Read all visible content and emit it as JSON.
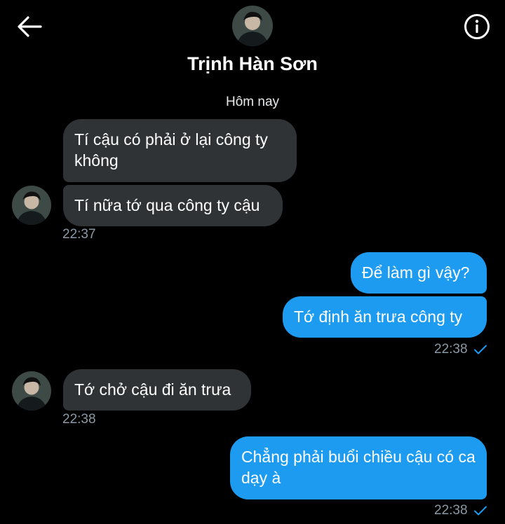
{
  "header": {
    "contact_name": "Trịnh Hàn Sơn",
    "back_icon": "arrow-left-icon",
    "info_icon": "info-circle-icon"
  },
  "date_separator": "Hôm nay",
  "messages": [
    {
      "direction": "in",
      "text": "Tí cậu có phải ở lại công ty không"
    },
    {
      "direction": "in",
      "text": "Tí nữa tớ qua công ty cậu",
      "time": "22:37"
    },
    {
      "direction": "out",
      "text": "Để làm gì vậy?"
    },
    {
      "direction": "out",
      "text": "Tớ định ăn trưa công ty",
      "time": "22:38"
    },
    {
      "direction": "in",
      "text": "Tớ chở cậu đi ăn trưa",
      "time": "22:38"
    },
    {
      "direction": "out",
      "text": "Chẳng phải buổi chiều cậu có ca dạy à",
      "time": "22:38"
    }
  ],
  "colors": {
    "background": "#000000",
    "incoming_bubble": "#2f3336",
    "outgoing_bubble": "#1d9bf0",
    "timestamp": "#8b98a5",
    "read_check": "#1d9bf0"
  }
}
